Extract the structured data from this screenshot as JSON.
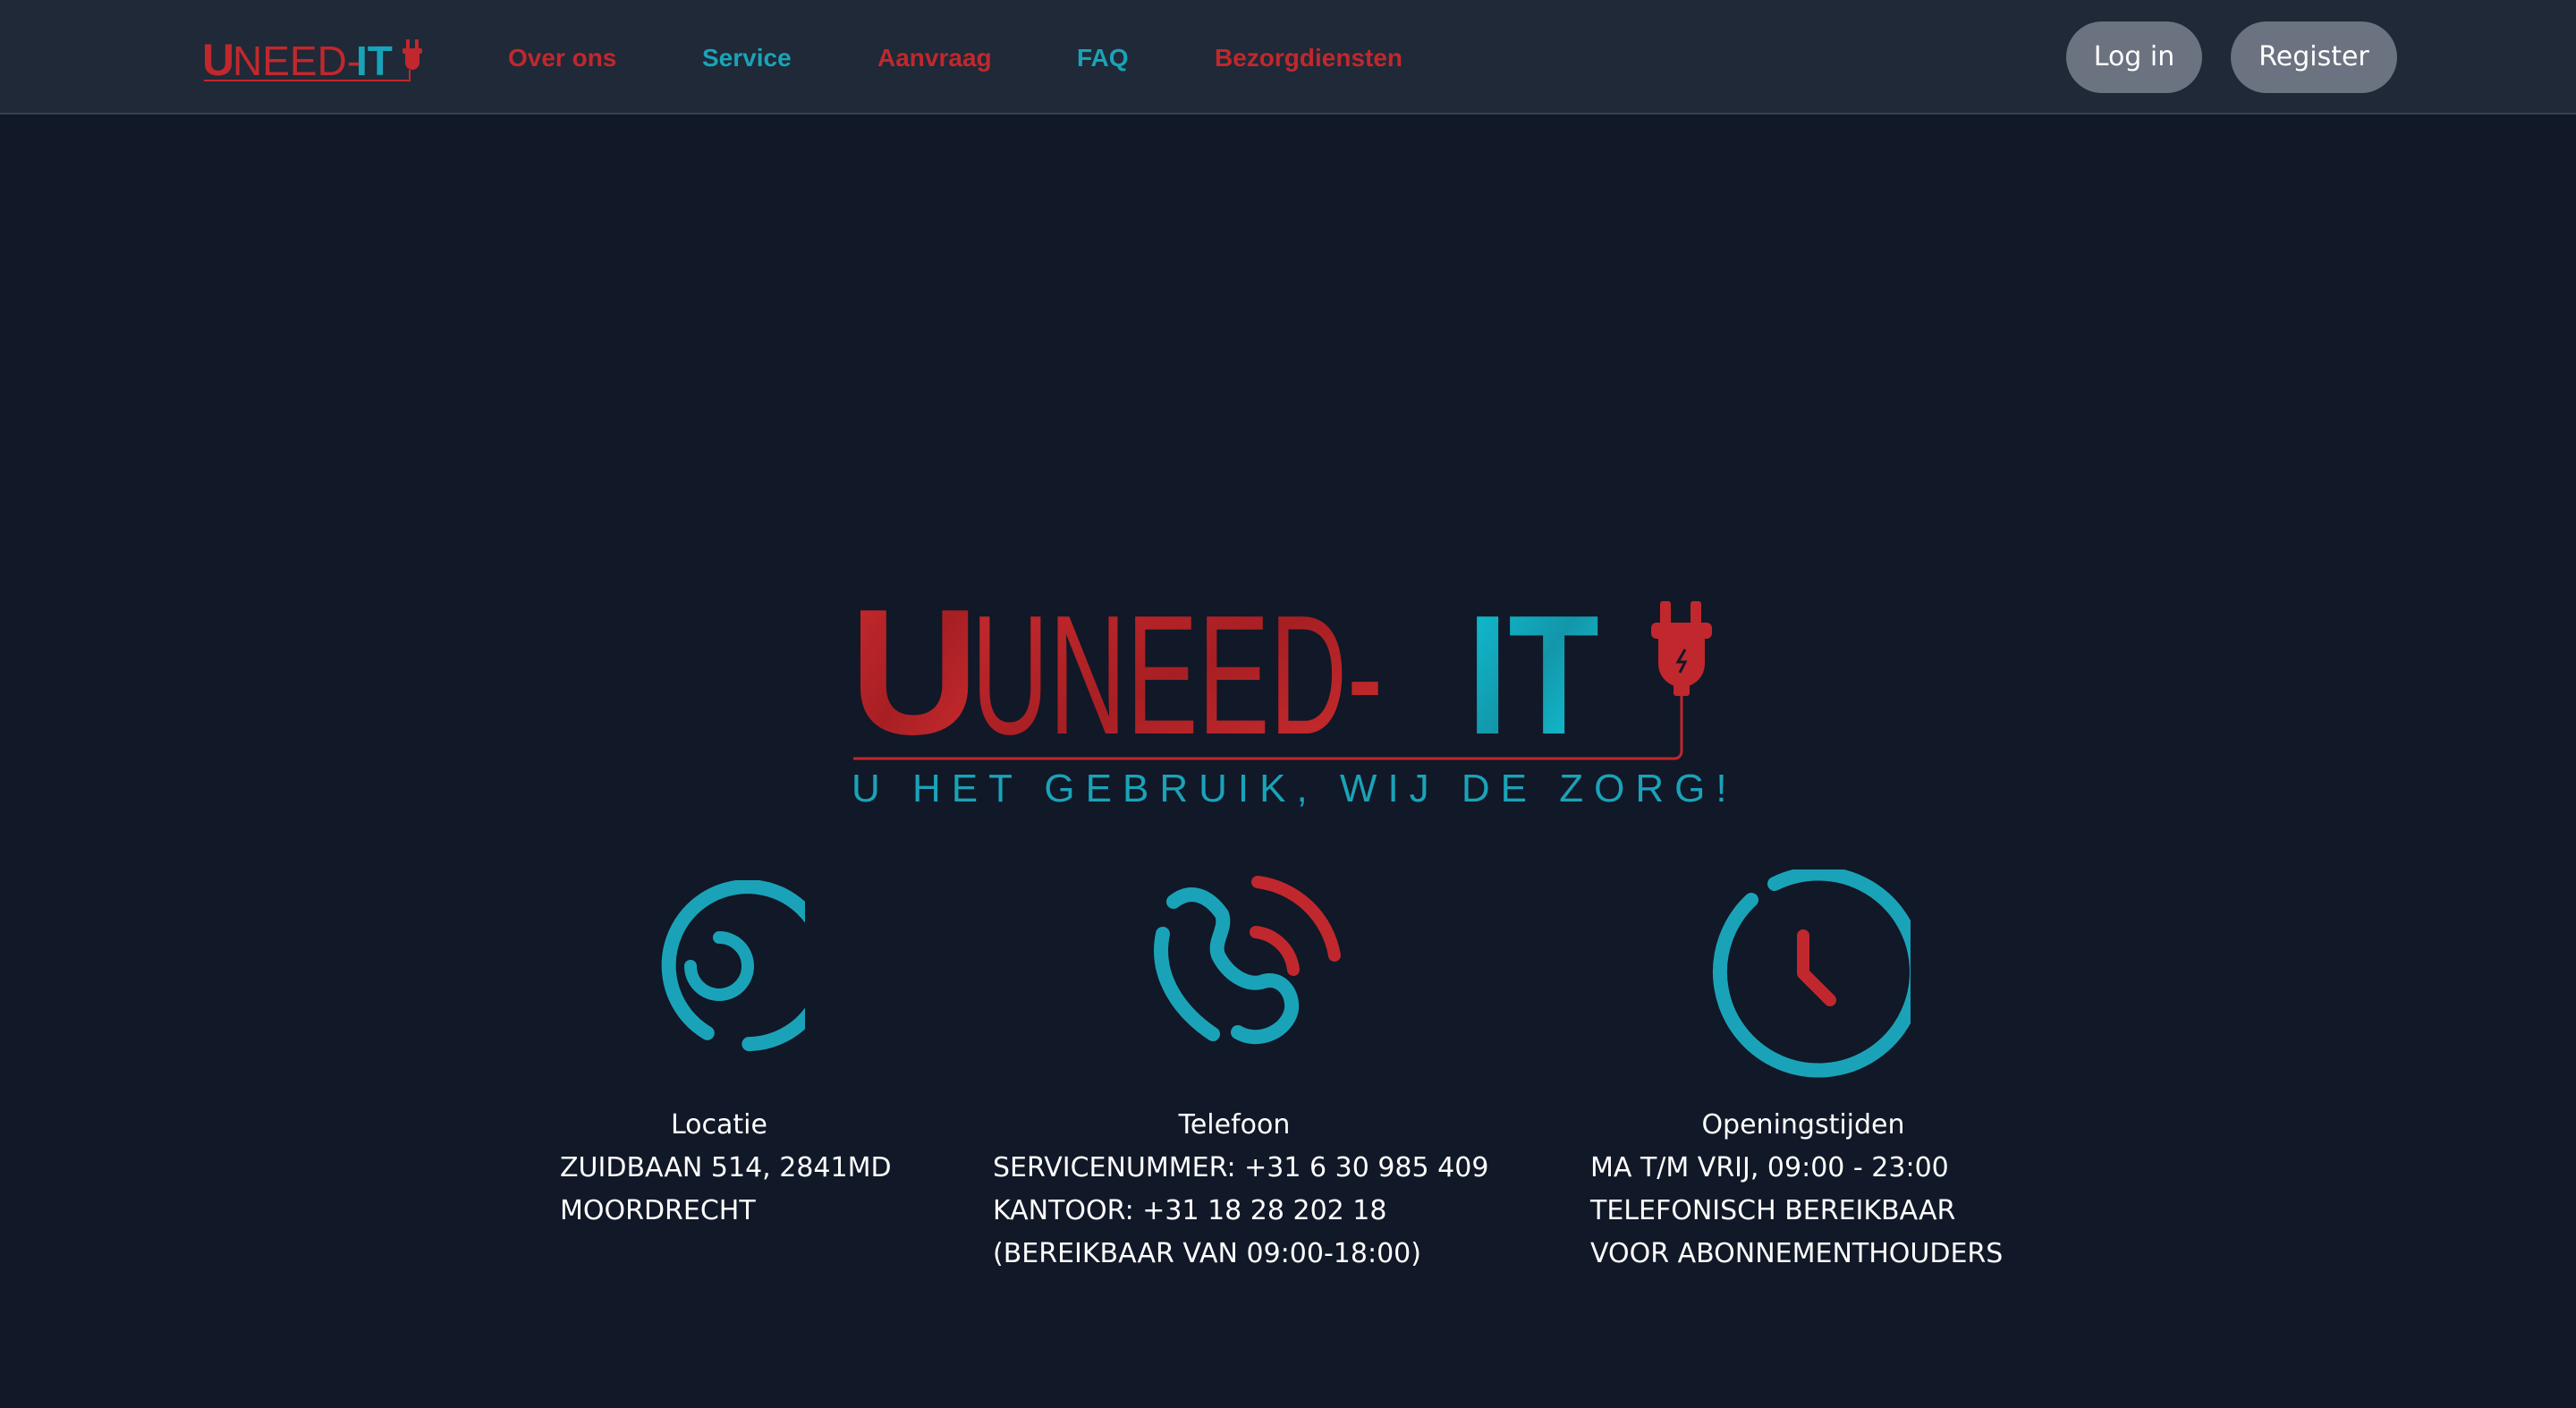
{
  "nav": {
    "logo_text": "UNEED-IT",
    "links": [
      {
        "label": "Over ons",
        "color": "#c0282d"
      },
      {
        "label": "Service",
        "color": "#1aa3b8"
      },
      {
        "label": "Aanvraag",
        "color": "#c0282d"
      },
      {
        "label": "FAQ",
        "color": "#1aa3b8"
      },
      {
        "label": "Bezorgdiensten",
        "color": "#c0282d"
      }
    ],
    "login_label": "Log in",
    "register_label": "Register"
  },
  "hero": {
    "logo_text_red": "UNEED-",
    "logo_text_teal": "IT",
    "tagline": "U HET GEBRUIK, WIJ DE ZORG!",
    "logo_icon": "plug-icon"
  },
  "info": {
    "location": {
      "icon": "location-icon",
      "title": "Locatie",
      "lines": [
        "ZUIDBAAN 514, 2841MD",
        "MOORDRECHT"
      ]
    },
    "phone": {
      "icon": "phone-icon",
      "title": "Telefoon",
      "lines": [
        "SERVICENUMMER: +31 6 30 985 409",
        "KANTOOR: +31 18 28 202 18",
        "(BEREIKBAAR VAN 09:00-18:00)"
      ]
    },
    "hours": {
      "icon": "clock-icon",
      "title": "Openingstijden",
      "lines": [
        "MA T/M VRIJ, 09:00 - 23:00",
        "TELEFONISCH BEREIKBAAR",
        "VOOR ABONNEMENTHOUDERS"
      ]
    }
  },
  "colors": {
    "background": "#111827",
    "navbar": "#1f2937",
    "brand_red": "#c0282d",
    "brand_teal": "#1aa3b8",
    "button": "#6b7280"
  }
}
